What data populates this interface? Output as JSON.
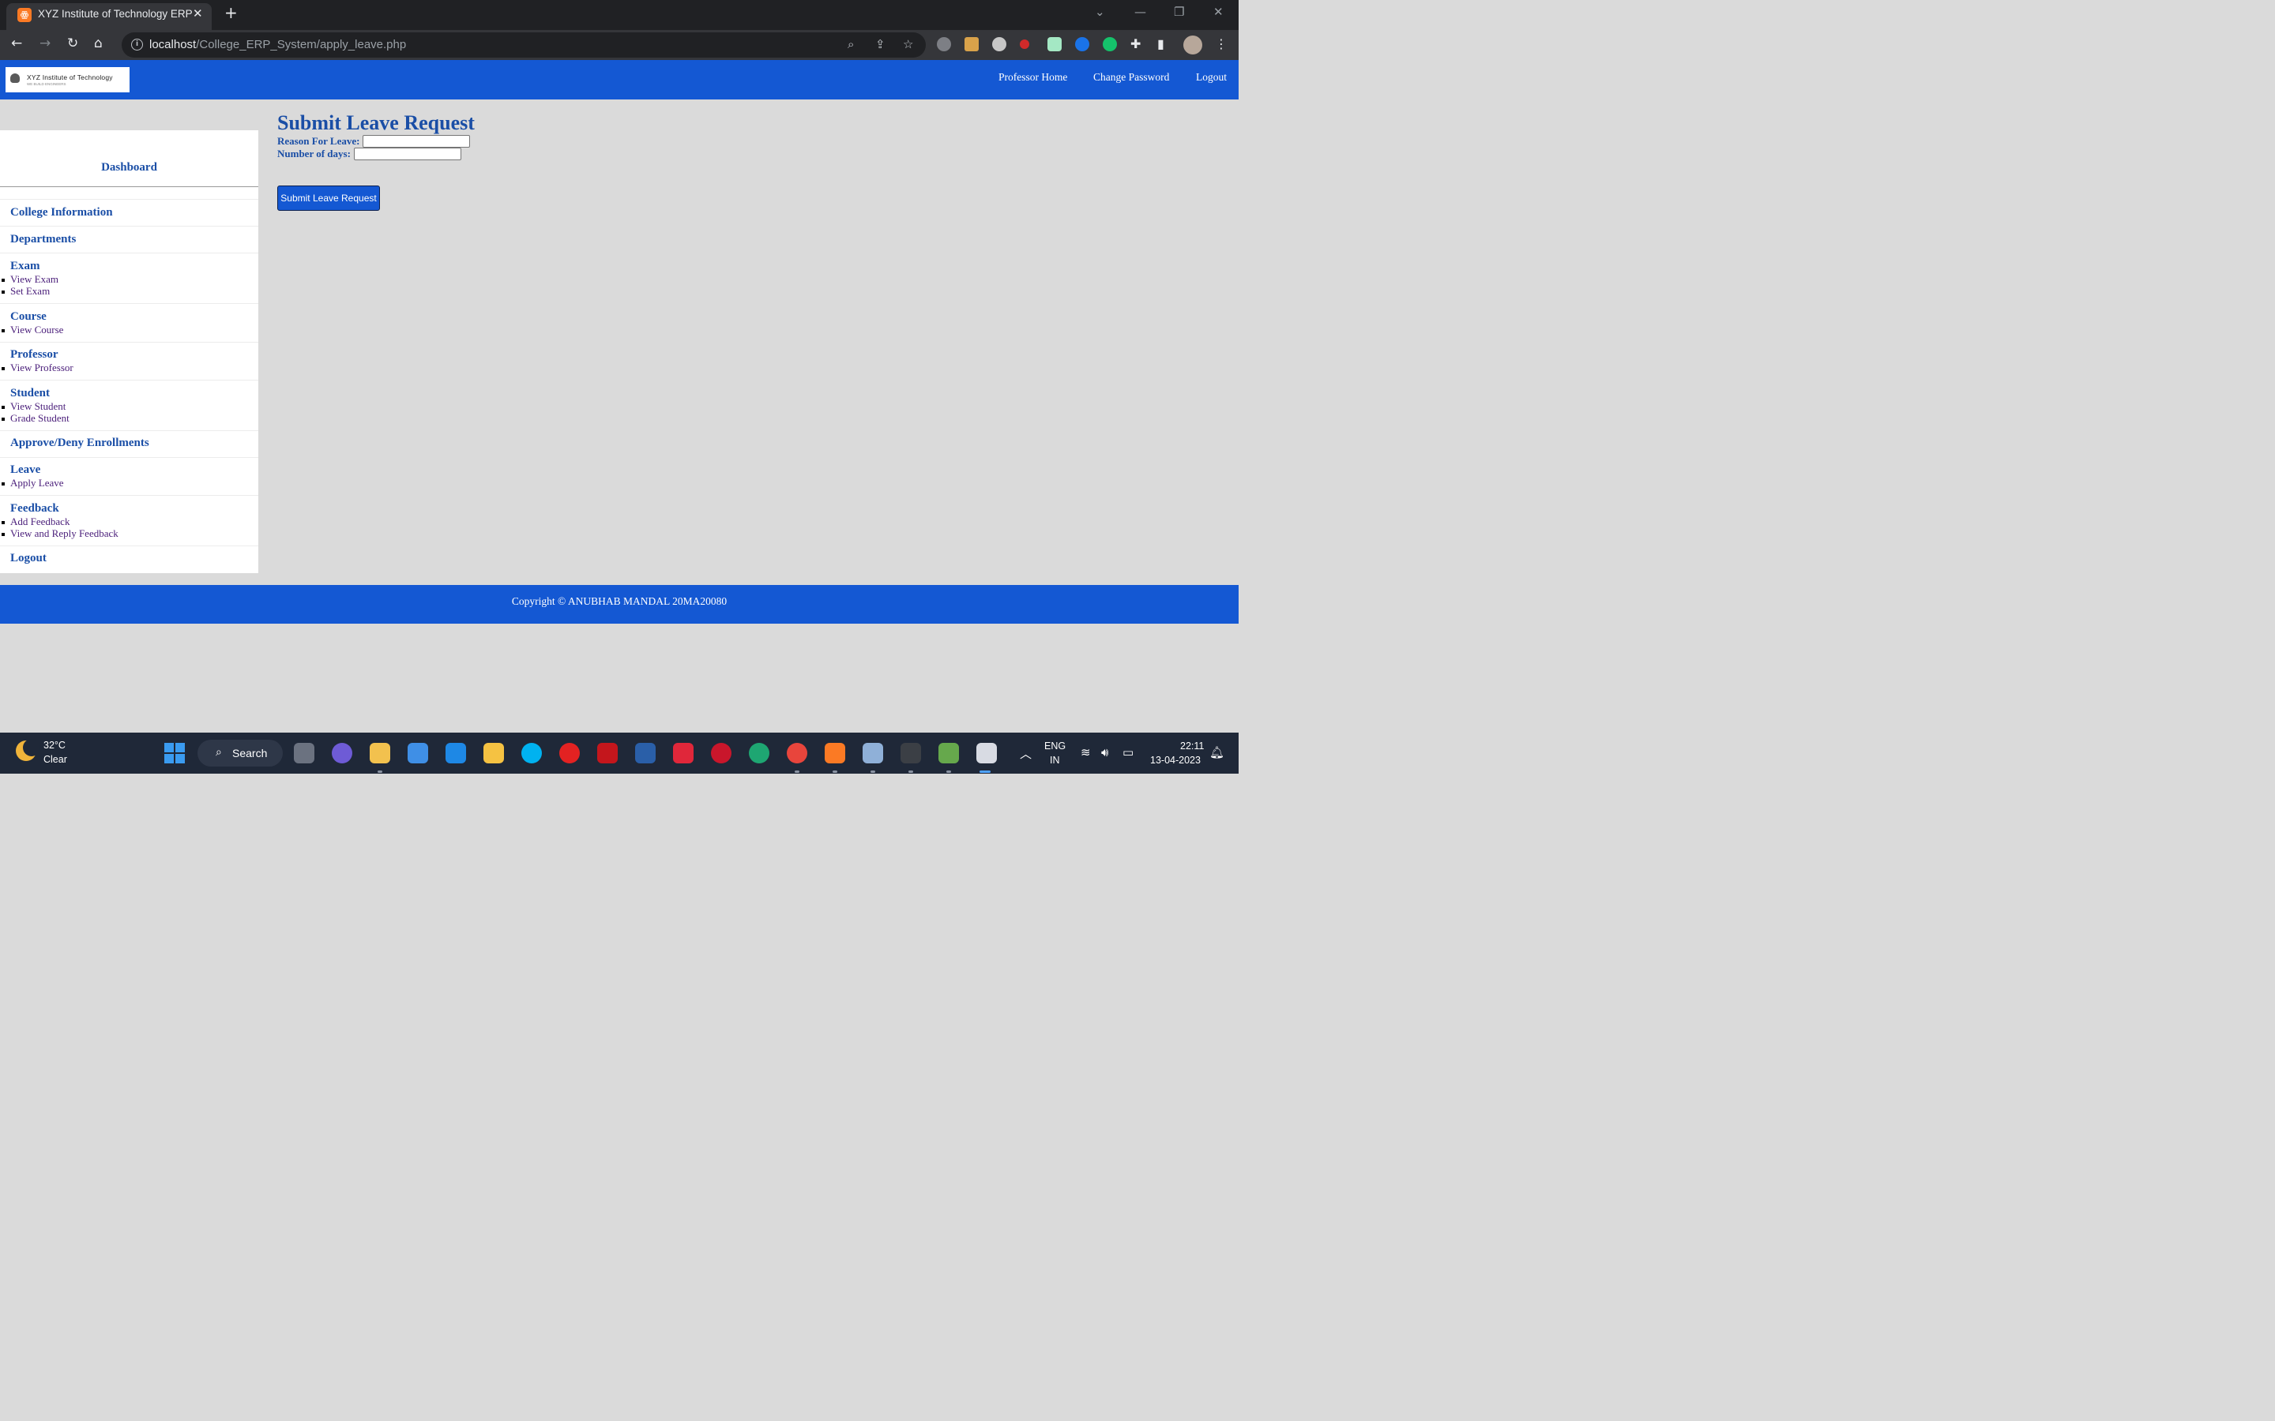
{
  "browser": {
    "tab_title": "XYZ Institute of Technology ERP",
    "url_host": "localhost",
    "url_path": "/College_ERP_System/apply_leave.php"
  },
  "header": {
    "logo_name": "XYZ Institute of Technology",
    "logo_tagline": "WE BUILD ENGINEERS",
    "nav": [
      "Professor Home",
      "Change Password",
      "Logout"
    ]
  },
  "sidebar": {
    "title": "Dashboard",
    "sections": [
      {
        "heading": "College Information",
        "items": []
      },
      {
        "heading": "Departments",
        "items": []
      },
      {
        "heading": "Exam",
        "items": [
          "View Exam",
          "Set Exam"
        ]
      },
      {
        "heading": "Course",
        "items": [
          "View Course"
        ]
      },
      {
        "heading": "Professor",
        "items": [
          "View Professor"
        ]
      },
      {
        "heading": "Student",
        "items": [
          "View Student",
          "Grade Student"
        ]
      },
      {
        "heading": "Approve/Deny Enrollments",
        "items": []
      },
      {
        "heading": "Leave",
        "items": [
          "Apply Leave"
        ]
      },
      {
        "heading": "Feedback",
        "items": [
          "Add Feedback",
          "View and Reply Feedback"
        ]
      },
      {
        "heading": "Logout",
        "items": []
      }
    ]
  },
  "main": {
    "title": "Submit Leave Request",
    "reason_label": "Reason For Leave:",
    "reason_value": "",
    "days_label": "Number of days:",
    "days_value": "",
    "submit_label": "Submit Leave Request"
  },
  "footer": {
    "copyright": "Copyright © ANUBHAB MANDAL 20MA20080"
  },
  "taskbar": {
    "weather_temp": "32°C",
    "weather_desc": "Clear",
    "search_label": "Search",
    "language": "ENG",
    "region": "IN",
    "time": "22:11",
    "date": "13-04-2023"
  },
  "colors": {
    "header_blue": "#1458d3",
    "heading_blue": "#1a4ea6",
    "link_purple": "#4a1e7a",
    "page_bg": "#dadada"
  }
}
